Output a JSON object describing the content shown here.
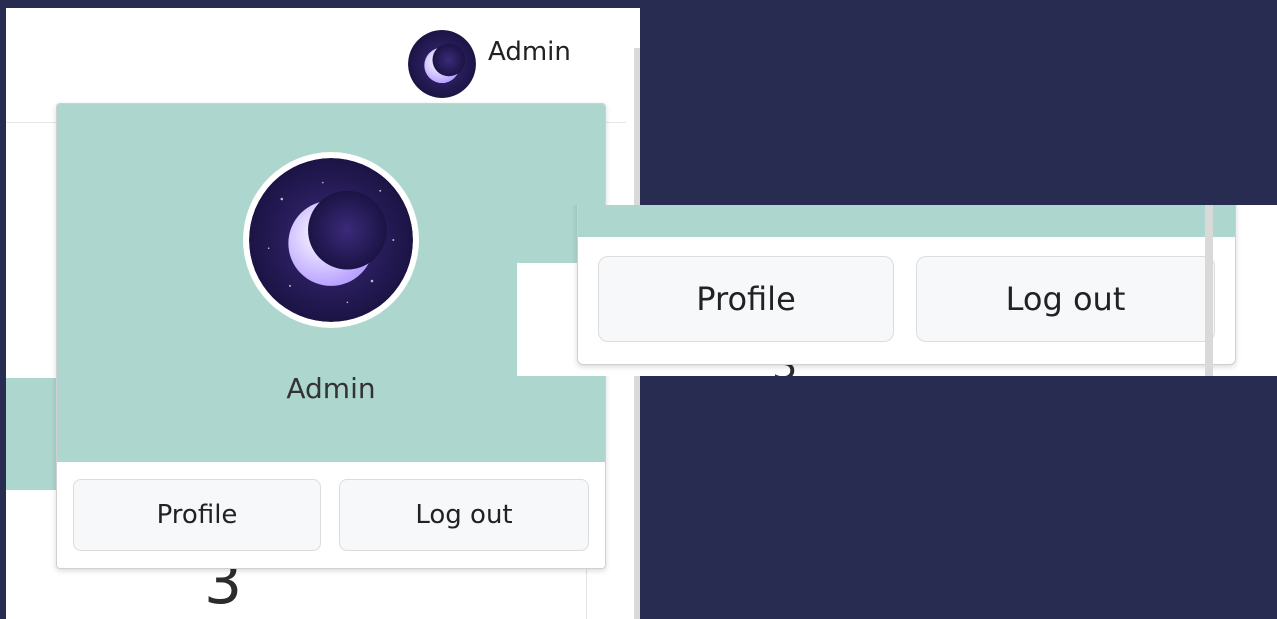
{
  "user_menu": {
    "username": "Admin",
    "avatar_icon": "moon-avatar-icon",
    "profile_label": "Profile",
    "logout_label": "Log out",
    "header_color": "#add6ce"
  },
  "page": {
    "visible_number": "3"
  },
  "zoom": {
    "profile_label": "Profile",
    "logout_label": "Log out"
  },
  "colors": {
    "background": "#292c51",
    "panel": "#ffffff",
    "accent": "#add6ce",
    "button_bg": "#f7f8fa"
  }
}
